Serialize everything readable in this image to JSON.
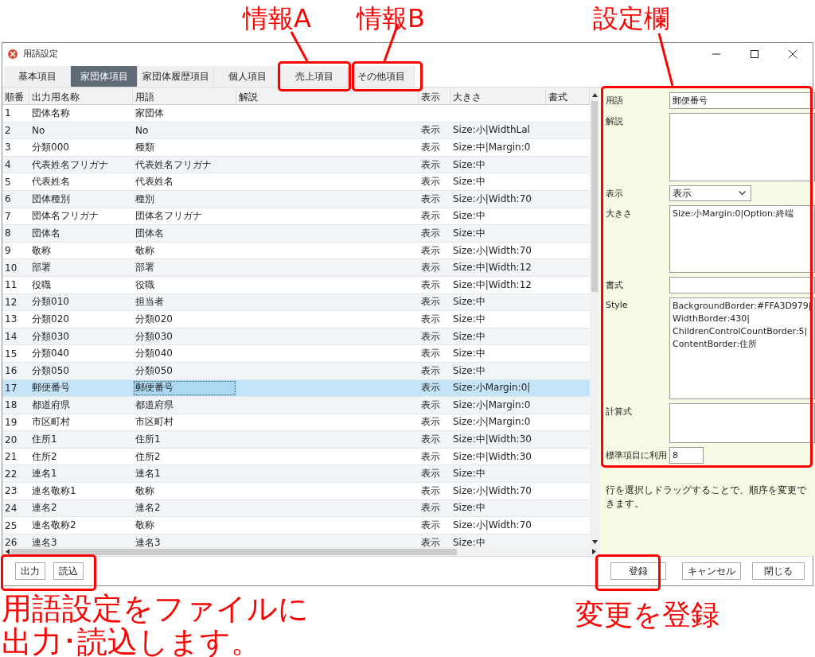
{
  "annotations": {
    "top": [
      "情報A",
      "情報B",
      "設定欄"
    ],
    "bottom_left": [
      "用語設定をファイルに",
      "出力･読込します。"
    ],
    "bottom_right": "変更を登録"
  },
  "window": {
    "title": "用語設定"
  },
  "tabs": [
    {
      "label": "基本項目",
      "selected": false
    },
    {
      "label": "家団体項目",
      "selected": true
    },
    {
      "label": "家団体履歴項目",
      "selected": false
    },
    {
      "label": "個人項目",
      "selected": false
    },
    {
      "label": "売上項目",
      "selected": false
    },
    {
      "label": "その他項目",
      "selected": false
    }
  ],
  "table": {
    "columns": [
      "順番",
      "出力用名称",
      "用語",
      "解説",
      "表示",
      "大きさ",
      "書式"
    ],
    "rows": [
      {
        "no": "1",
        "output_name": "団体名称",
        "term": "家団体",
        "display": "",
        "size": "",
        "selected": false
      },
      {
        "no": "2",
        "output_name": "No",
        "term": "No",
        "display": "表示",
        "size": "Size:小|WidthLal",
        "selected": false
      },
      {
        "no": "3",
        "output_name": "分類000",
        "term": "種類",
        "display": "表示",
        "size": "Size:中|Margin:0",
        "selected": false
      },
      {
        "no": "4",
        "output_name": "代表姓名フリガナ",
        "term": "代表姓名フリガナ",
        "display": "表示",
        "size": "Size:中",
        "selected": false
      },
      {
        "no": "5",
        "output_name": "代表姓名",
        "term": "代表姓名",
        "display": "表示",
        "size": "Size:中",
        "selected": false
      },
      {
        "no": "6",
        "output_name": "団体種別",
        "term": "種別",
        "display": "表示",
        "size": "Size:小|Width:70",
        "selected": false
      },
      {
        "no": "7",
        "output_name": "団体名フリガナ",
        "term": "団体名フリガナ",
        "display": "表示",
        "size": "Size:中",
        "selected": false
      },
      {
        "no": "8",
        "output_name": "団体名",
        "term": "団体名",
        "display": "表示",
        "size": "Size:中",
        "selected": false
      },
      {
        "no": "9",
        "output_name": "敬称",
        "term": "敬称",
        "display": "表示",
        "size": "Size:小|Width:70",
        "selected": false
      },
      {
        "no": "10",
        "output_name": "部署",
        "term": "部署",
        "display": "表示",
        "size": "Size:中|Width:12",
        "selected": false
      },
      {
        "no": "11",
        "output_name": "役職",
        "term": "役職",
        "display": "表示",
        "size": "Size:中|Width:12",
        "selected": false
      },
      {
        "no": "12",
        "output_name": "分類010",
        "term": "担当者",
        "display": "表示",
        "size": "Size:中",
        "selected": false
      },
      {
        "no": "13",
        "output_name": "分類020",
        "term": "分類020",
        "display": "表示",
        "size": "Size:中",
        "selected": false
      },
      {
        "no": "14",
        "output_name": "分類030",
        "term": "分類030",
        "display": "表示",
        "size": "Size:中",
        "selected": false
      },
      {
        "no": "15",
        "output_name": "分類040",
        "term": "分類040",
        "display": "表示",
        "size": "Size:中",
        "selected": false
      },
      {
        "no": "16",
        "output_name": "分類050",
        "term": "分類050",
        "display": "表示",
        "size": "Size:中",
        "selected": false
      },
      {
        "no": "17",
        "output_name": "郵便番号",
        "term": "郵便番号",
        "display": "表示",
        "size": "Size:小Margin:0|",
        "selected": true
      },
      {
        "no": "18",
        "output_name": "都道府県",
        "term": "都道府県",
        "display": "表示",
        "size": "Size:小|Margin:0",
        "selected": false
      },
      {
        "no": "19",
        "output_name": "市区町村",
        "term": "市区町村",
        "display": "表示",
        "size": "Size:小|Margin:0",
        "selected": false
      },
      {
        "no": "20",
        "output_name": "住所1",
        "term": "住所1",
        "display": "表示",
        "size": "Size:中|Width:30",
        "selected": false
      },
      {
        "no": "21",
        "output_name": "住所2",
        "term": "住所2",
        "display": "表示",
        "size": "Size:中|Width:30",
        "selected": false
      },
      {
        "no": "22",
        "output_name": "連名1",
        "term": "連名1",
        "display": "表示",
        "size": "Size:中",
        "selected": false
      },
      {
        "no": "23",
        "output_name": "連名敬称1",
        "term": "敬称",
        "display": "表示",
        "size": "Size:小|Width:70",
        "selected": false
      },
      {
        "no": "24",
        "output_name": "連名2",
        "term": "連名2",
        "display": "表示",
        "size": "Size:中",
        "selected": false
      },
      {
        "no": "25",
        "output_name": "連名敬称2",
        "term": "敬称",
        "display": "表示",
        "size": "Size:小|Width:70",
        "selected": false
      },
      {
        "no": "26",
        "output_name": "連名3",
        "term": "連名3",
        "display": "表示",
        "size": "Size:中",
        "selected": false
      }
    ]
  },
  "settings": {
    "fields": [
      {
        "label": "用語",
        "kind": "input",
        "value": "郵便番号"
      },
      {
        "label": "解説",
        "kind": "textarea"
      },
      {
        "label": "表示",
        "kind": "select",
        "value": "表示"
      },
      {
        "label": "大きさ",
        "kind": "textarea",
        "value": "Size:小Margin:0|Option:終端"
      },
      {
        "label": "書式",
        "kind": "input"
      },
      {
        "label": "Style",
        "kind": "textarea",
        "value": "BackgroundBorder:#FFA3D979|\nWidthBorder:430|\nChildrenControlCountBorder:5|\nContentBorder:住所"
      },
      {
        "label": "計算式",
        "kind": "textarea"
      },
      {
        "label": "標準項目に利用",
        "kind": "short",
        "value": "8"
      }
    ],
    "note": "行を選択しドラッグすることで、順序を変更できます。"
  },
  "buttons_left": [
    "出力",
    "読込"
  ],
  "buttons_right": [
    "登録",
    "キャンセル",
    "閉じる"
  ]
}
